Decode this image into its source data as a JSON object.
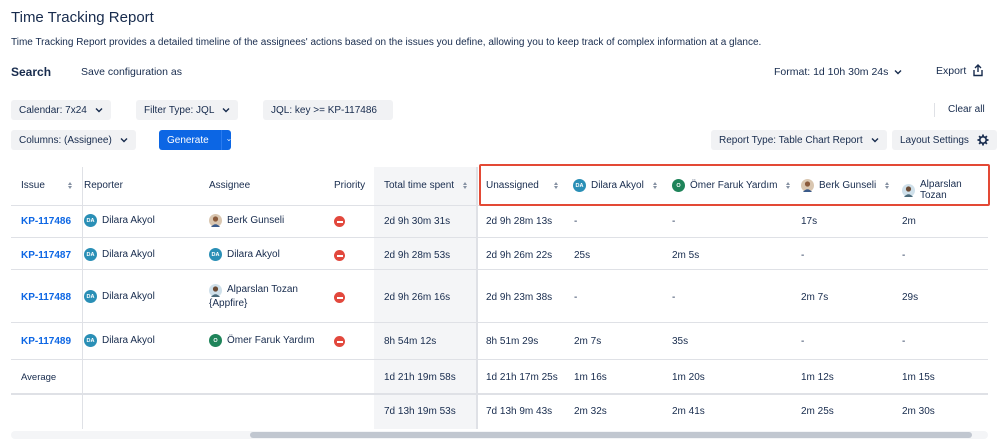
{
  "page": {
    "title": "Time Tracking Report",
    "description": "Time Tracking Report provides a detailed timeline of the assignees' actions based on the issues you define, allowing you to keep track of complex information at a glance."
  },
  "toolbar": {
    "search_label": "Search",
    "save_config": "Save configuration as",
    "format": "Format: 1d 10h 30m 24s",
    "export": "Export",
    "calendar": "Calendar: 7x24",
    "filter_type": "Filter Type: JQL",
    "jql": "JQL: key >= KP-117486",
    "clear_all": "Clear all",
    "columns": "Columns: (Assignee)",
    "generate": "Generate",
    "report_type": "Report Type: Table Chart Report",
    "layout_settings": "Layout Settings"
  },
  "table": {
    "headers": {
      "issue": "Issue",
      "reporter": "Reporter",
      "assignee": "Assignee",
      "priority": "Priority",
      "total": "Total time spent",
      "unassigned": "Unassigned",
      "dilara": "Dilara Akyol",
      "omer": "Ömer Faruk Yardım",
      "berk": "Berk Gunseli",
      "alparslan": "Alparslan Tozan"
    },
    "rows": [
      {
        "issue": "KP-117486",
        "reporter": "Dilara Akyol",
        "assignee": "Berk Gunseli",
        "assignee_extra": "",
        "total": "2d 9h 30m 31s",
        "unassigned": "2d 9h 28m 13s",
        "dilara": "-",
        "omer": "-",
        "berk": "17s",
        "alparslan": "2m"
      },
      {
        "issue": "KP-117487",
        "reporter": "Dilara Akyol",
        "assignee": "Dilara Akyol",
        "assignee_extra": "",
        "total": "2d 9h 28m 53s",
        "unassigned": "2d 9h 26m 22s",
        "dilara": "25s",
        "omer": "2m 5s",
        "berk": "-",
        "alparslan": "-"
      },
      {
        "issue": "KP-117488",
        "reporter": "Dilara Akyol",
        "assignee": "Alparslan Tozan",
        "assignee_extra": "{Appfire}",
        "total": "2d 9h 26m 16s",
        "unassigned": "2d 9h 23m 38s",
        "dilara": "-",
        "omer": "-",
        "berk": "2m 7s",
        "alparslan": "29s"
      },
      {
        "issue": "KP-117489",
        "reporter": "Dilara Akyol",
        "assignee": "Ömer Faruk Yardım",
        "assignee_extra": "",
        "total": "8h 54m 12s",
        "unassigned": "8h 51m 29s",
        "dilara": "2m 7s",
        "omer": "35s",
        "berk": "-",
        "alparslan": "-"
      }
    ],
    "average": {
      "label": "Average",
      "total": "1d 21h 19m 58s",
      "unassigned": "1d 21h 17m 25s",
      "dilara": "1m 16s",
      "omer": "1m 20s",
      "berk": "1m 12s",
      "alparslan": "1m 15s"
    },
    "totals": {
      "total": "7d 13h 19m 53s",
      "unassigned": "7d 13h 9m 43s",
      "dilara": "2m 32s",
      "omer": "2m 41s",
      "berk": "2m 25s",
      "alparslan": "2m 30s"
    },
    "avatar_initials": {
      "da": "DA",
      "o": "O"
    }
  },
  "colors": {
    "primary": "#0c66e4",
    "highlight": "#e34935",
    "priority": "#e2483d"
  }
}
